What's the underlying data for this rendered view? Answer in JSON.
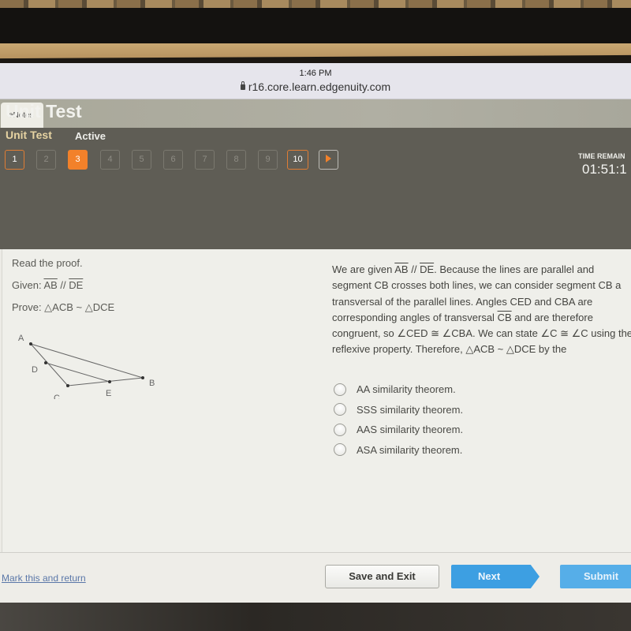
{
  "browser": {
    "time": "1:46 PM",
    "url": "r16.core.learn.edgenuity.com"
  },
  "tabs": {
    "enotes_label": "eNotes"
  },
  "header": {
    "title": "Unit Test",
    "subtitle": "Unit Test",
    "status": "Active",
    "questions": [
      {
        "label": "1",
        "state": "visited"
      },
      {
        "label": "2",
        "state": "unvisited"
      },
      {
        "label": "3",
        "state": "current"
      },
      {
        "label": "4",
        "state": "unvisited"
      },
      {
        "label": "5",
        "state": "unvisited"
      },
      {
        "label": "6",
        "state": "unvisited"
      },
      {
        "label": "7",
        "state": "unvisited"
      },
      {
        "label": "8",
        "state": "unvisited"
      },
      {
        "label": "9",
        "state": "unvisited"
      },
      {
        "label": "10",
        "state": "visited"
      }
    ],
    "next_arrow_icon": "play-icon",
    "time_remaining_label": "TIME REMAIN",
    "time_remaining_value": "01:51:1"
  },
  "question": {
    "instruction": "Read the proof.",
    "given_prefix": "Given: ",
    "given_seg1": "AB",
    "given_parallel": " // ",
    "given_seg2": "DE",
    "prove": "Prove: △ACB ~ △DCE",
    "figure_labels": {
      "A": "A",
      "B": "B",
      "C": "C",
      "D": "D",
      "E": "E"
    },
    "passage_part1": "We are given ",
    "passage_seg1": "AB",
    "passage_parallel": " // ",
    "passage_seg2": "DE",
    "passage_part2": ".  Because the lines are parallel and segment CB crosses both lines, we can consider segment CB a transversal of the parallel lines. Angles CED and CBA are corresponding angles of transversal ",
    "passage_seg3": "CB",
    "passage_part3": " and are therefore congruent, so ∠CED ≅ ∠CBA. We can state ∠C ≅ ∠C using the reflexive property. Therefore, △ACB ~ △DCE by the",
    "choices": [
      "AA similarity theorem.",
      "SSS similarity theorem.",
      "AAS similarity theorem.",
      "ASA similarity theorem."
    ]
  },
  "footer": {
    "mark_link": "Mark this and return",
    "save_exit": "Save and Exit",
    "next": "Next",
    "submit": "Submit"
  },
  "colors": {
    "accent_orange": "#f2812a",
    "button_blue": "#3d9fe2",
    "header_bg": "#5f5d55"
  }
}
